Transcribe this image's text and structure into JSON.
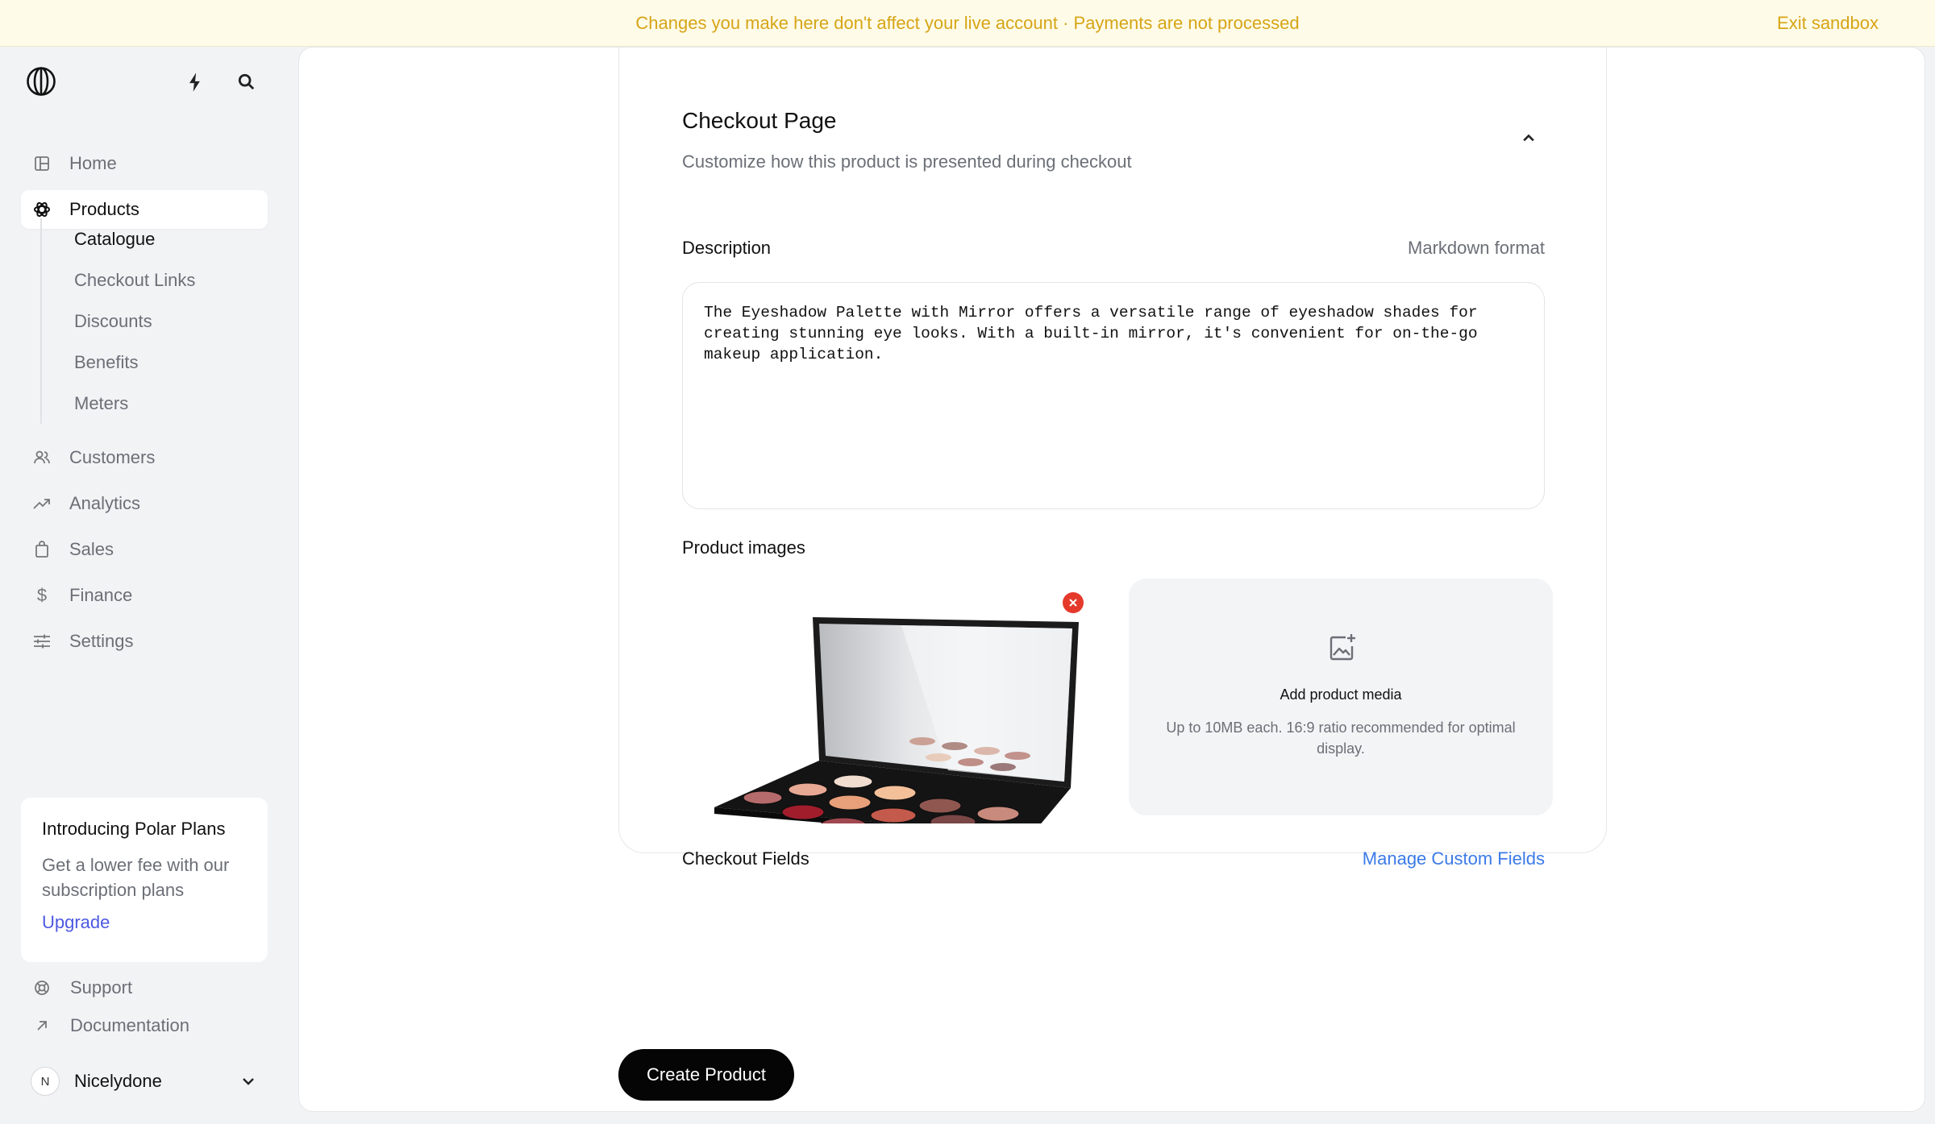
{
  "banner": {
    "message": "Changes you make here don't affect your live account · Payments are not processed",
    "exit_label": "Exit sandbox",
    "color": "#d6a516"
  },
  "sidebar": {
    "nav": [
      {
        "label": "Home",
        "icon": "dashboard-icon"
      },
      {
        "label": "Products",
        "icon": "products-icon",
        "active": true
      },
      {
        "label": "Customers",
        "icon": "users-icon"
      },
      {
        "label": "Analytics",
        "icon": "trending-up-icon"
      },
      {
        "label": "Sales",
        "icon": "shopping-bag-icon"
      },
      {
        "label": "Finance",
        "icon": "dollar-icon"
      },
      {
        "label": "Settings",
        "icon": "sliders-icon"
      }
    ],
    "subnav": [
      {
        "label": "Catalogue",
        "active": true
      },
      {
        "label": "Checkout Links"
      },
      {
        "label": "Discounts"
      },
      {
        "label": "Benefits"
      },
      {
        "label": "Meters"
      }
    ],
    "promo": {
      "title": "Introducing Polar Plans",
      "body": "Get a lower fee with our subscription plans",
      "link": "Upgrade"
    },
    "footer": [
      {
        "label": "Support",
        "icon": "lifebuoy-icon"
      },
      {
        "label": "Documentation",
        "icon": "arrow-up-right-icon"
      }
    ],
    "account": {
      "initial": "N",
      "name": "Nicelydone"
    }
  },
  "checkout": {
    "title": "Checkout Page",
    "subtitle": "Customize how this product is presented during checkout",
    "description_label": "Description",
    "description_hint": "Markdown format",
    "description_value": "The Eyeshadow Palette with Mirror offers a versatile range of eyeshadow shades for\ncreating stunning eye looks. With a built-in mirror, it's convenient for on-the-go\nmakeup application.",
    "images_label": "Product images",
    "upload_title": "Add product media",
    "upload_desc": "Up to 10MB each. 16:9 ratio recommended for optimal display.",
    "fields_label": "Checkout Fields",
    "manage_link": "Manage Custom Fields"
  },
  "primary_button": "Create Product",
  "colors": {
    "accent_link": "#3b7ae8",
    "upgrade_link": "#4d58e0",
    "remove_badge": "#e5392b",
    "sidebar_bg": "#f2f3f5"
  }
}
